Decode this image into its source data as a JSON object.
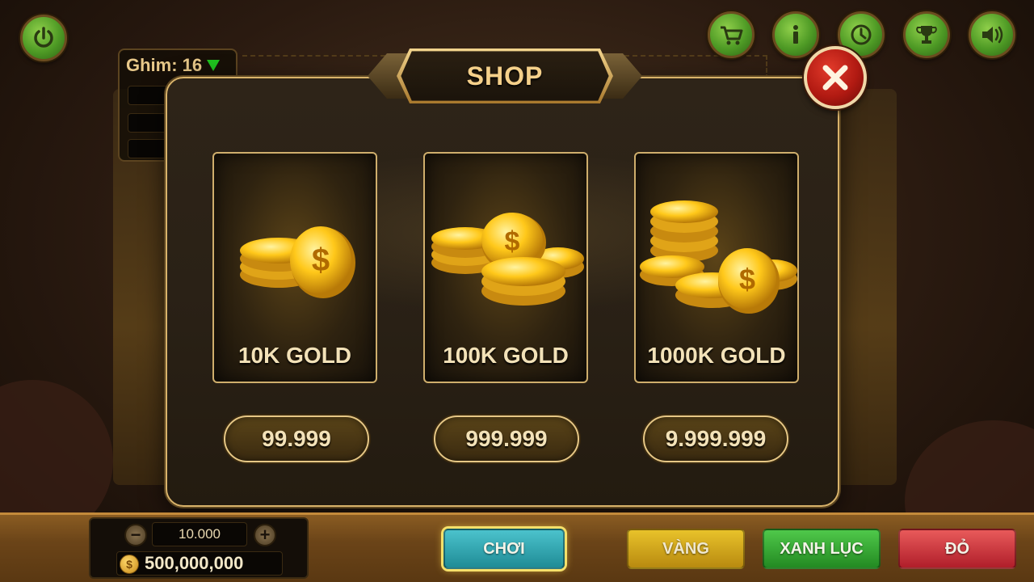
{
  "hud": {
    "pin_label": "Ghim: 16",
    "icons": [
      "power-icon",
      "cart-icon",
      "info-icon",
      "history-icon",
      "trophy-icon",
      "speaker-icon"
    ]
  },
  "shop": {
    "title": "SHOP",
    "packages": [
      {
        "label": "10K GOLD",
        "price": "99.999"
      },
      {
        "label": "100K GOLD",
        "price": "999.999"
      },
      {
        "label": "1000K GOLD",
        "price": "9.999.999"
      }
    ]
  },
  "bottom": {
    "bet_value": "10.000",
    "balance": "500,000,000",
    "minus": "−",
    "plus": "+",
    "coin_symbol": "$",
    "buttons": {
      "play": "CHƠI",
      "gold": "VÀNG",
      "green": "XANH LỤC",
      "red": "ĐỎ"
    }
  },
  "colors": {
    "accent_gold": "#d9b36a",
    "round_button": "#4e9a25",
    "close_red": "#b11a12",
    "play_teal": "#1f8c96",
    "gold_yellow": "#e8c22a",
    "green": "#4fc84a",
    "red": "#e85a5a"
  }
}
